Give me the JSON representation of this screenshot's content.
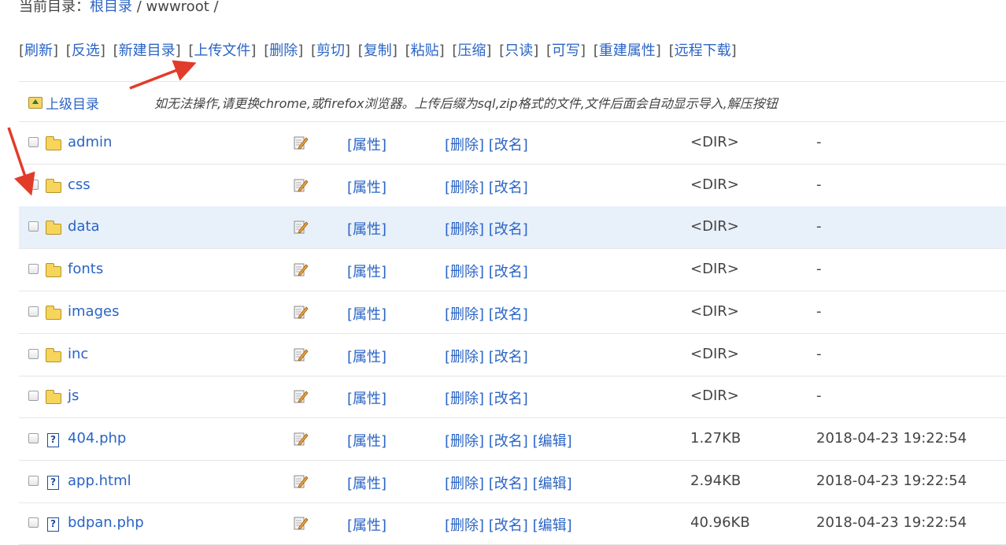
{
  "breadcrumb": {
    "label": "当前目录：",
    "root": "根目录",
    "separator": " / ",
    "current": "wwwroot",
    "trailing": " /"
  },
  "toolbar": [
    {
      "label": "刷新"
    },
    {
      "label": "反选"
    },
    {
      "label": "新建目录"
    },
    {
      "label": "上传文件"
    },
    {
      "label": "删除"
    },
    {
      "label": "剪切"
    },
    {
      "label": "复制"
    },
    {
      "label": "粘贴"
    },
    {
      "label": "压缩"
    },
    {
      "label": "只读"
    },
    {
      "label": "可写"
    },
    {
      "label": "重建属性"
    },
    {
      "label": "远程下载"
    }
  ],
  "parent_dir": {
    "label": "上级目录",
    "notice": "如无法操作,请更换chrome,或firefox浏览器。上传后缀为sql,zip格式的文件,文件后面会自动显示导入,解压按钮"
  },
  "actions": {
    "attr": "[属性]",
    "delete": "[删除]",
    "rename": "[改名]",
    "edit": "[编辑]"
  },
  "files": [
    {
      "name": "admin",
      "type": "dir",
      "size": "<DIR>",
      "mtime": "-"
    },
    {
      "name": "css",
      "type": "dir",
      "size": "<DIR>",
      "mtime": "-"
    },
    {
      "name": "data",
      "type": "dir",
      "size": "<DIR>",
      "mtime": "-"
    },
    {
      "name": "fonts",
      "type": "dir",
      "size": "<DIR>",
      "mtime": "-"
    },
    {
      "name": "images",
      "type": "dir",
      "size": "<DIR>",
      "mtime": "-"
    },
    {
      "name": "inc",
      "type": "dir",
      "size": "<DIR>",
      "mtime": "-"
    },
    {
      "name": "js",
      "type": "dir",
      "size": "<DIR>",
      "mtime": "-"
    },
    {
      "name": "404.php",
      "type": "file",
      "size": "1.27KB",
      "mtime": "2018-04-23 19:22:54"
    },
    {
      "name": "app.html",
      "type": "file",
      "size": "2.94KB",
      "mtime": "2018-04-23 19:22:54"
    },
    {
      "name": "bdpan.php",
      "type": "file",
      "size": "40.96KB",
      "mtime": "2018-04-23 19:22:54"
    }
  ],
  "icons": {
    "folder": "folder-icon",
    "file": "unknown-file-icon",
    "edit": "pencil-edit-icon",
    "parent": "up-folder-icon"
  },
  "colors": {
    "link": "#2a64c5",
    "highlight_row": "#e8f0fa",
    "annotation_arrow": "#e23b2a"
  }
}
